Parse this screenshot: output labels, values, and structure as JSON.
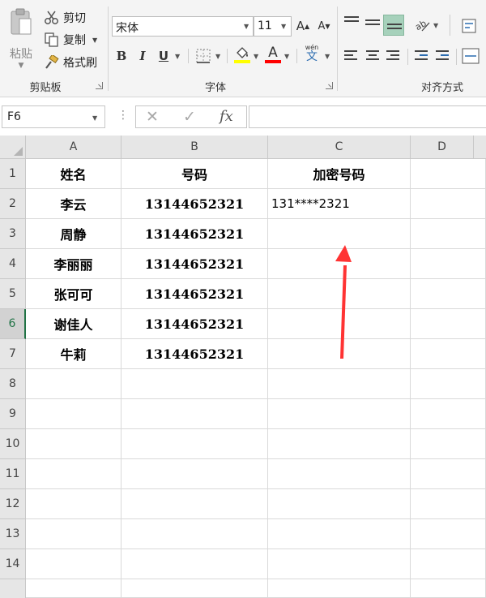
{
  "ribbon": {
    "clipboard": {
      "paste_label": "粘贴",
      "cut_label": "剪切",
      "copy_label": "复制",
      "format_painter_label": "格式刷",
      "group_label": "剪贴板"
    },
    "font": {
      "font_name": "宋体",
      "font_size": "11",
      "grow_label": "A",
      "shrink_label": "A",
      "bold_label": "B",
      "italic_label": "I",
      "underline_label": "U",
      "font_color_label": "A",
      "phonetic_label": "wén",
      "phonetic_char": "文",
      "group_label": "字体",
      "highlight_color": "#ffff00",
      "font_color": "#ff0000"
    },
    "alignment": {
      "group_label": "对齐方式"
    }
  },
  "formula_bar": {
    "name_box": "F6",
    "cancel_icon": "✕",
    "enter_icon": "✓",
    "fx_label": "fx",
    "formula": ""
  },
  "sheet": {
    "columns": [
      "A",
      "B",
      "C",
      "D"
    ],
    "rows": [
      "1",
      "2",
      "3",
      "4",
      "5",
      "6",
      "7",
      "8",
      "9",
      "10",
      "11",
      "12",
      "13",
      "14"
    ],
    "active_row": "6",
    "header": {
      "a": "姓名",
      "b": "号码",
      "c": "加密号码"
    },
    "data": [
      {
        "name": "李云",
        "number": "13144652321",
        "encrypted": "131****2321"
      },
      {
        "name": "周静",
        "number": "13144652321",
        "encrypted": ""
      },
      {
        "name": "李丽丽",
        "number": "13144652321",
        "encrypted": ""
      },
      {
        "name": "张可可",
        "number": "13144652321",
        "encrypted": ""
      },
      {
        "name": "谢佳人",
        "number": "13144652321",
        "encrypted": ""
      },
      {
        "name": "牛莉",
        "number": "13144652321",
        "encrypted": ""
      }
    ],
    "annotation_arrow_color": "#ff3333"
  }
}
